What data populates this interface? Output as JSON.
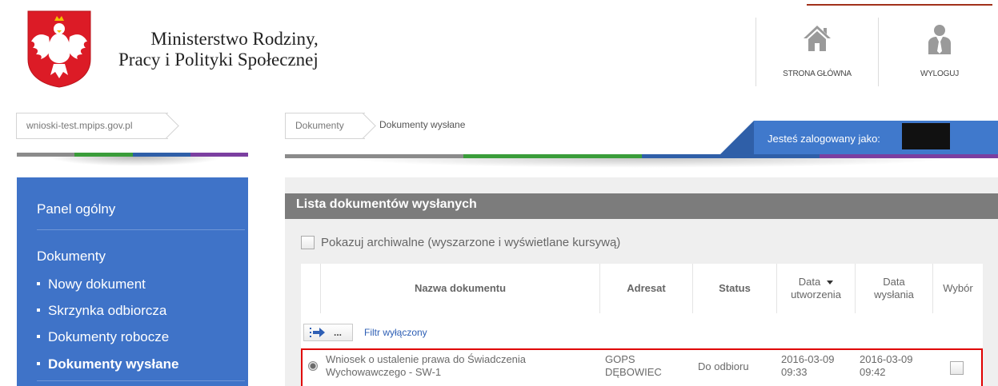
{
  "header": {
    "ministry_line1": "Ministerstwo Rodziny,",
    "ministry_line2": "Pracy i Polityki Społecznej",
    "home_label": "STRONA GŁÓWNA",
    "logout_label": "WYLOGUJ",
    "accent_color": "#a1311a"
  },
  "domain_crumb": "wnioski-test.mpips.gov.pl",
  "breadcrumb": {
    "level1": "Dokumenty",
    "level2": "Dokumenty wysłane"
  },
  "logged_in": {
    "text": "Jesteś zalogowany jako:"
  },
  "stripe_colors": [
    "#8b8b8b",
    "#3a9d3a",
    "#2f5fa8",
    "#7b3fa0"
  ],
  "sidebar": {
    "panel": "Panel ogólny",
    "section": "Dokumenty",
    "items": [
      {
        "label": "Nowy dokument"
      },
      {
        "label": "Skrzynka odbiorcza"
      },
      {
        "label": "Dokumenty robocze"
      },
      {
        "label": "Dokumenty wysłane"
      }
    ],
    "bg_color": "#3f73c8"
  },
  "list": {
    "title": "Lista dokumentów wysłanych",
    "archive_label": "Pokazuj archiwalne (wyszarzone i wyświetlane kursywą)",
    "columns": {
      "name": "Nazwa dokumentu",
      "addressee": "Adresat",
      "status": "Status",
      "created_1": "Data",
      "created_2": "utworzenia",
      "sent_1": "Data",
      "sent_2": "wysłania",
      "select": "Wybór"
    },
    "filter_button": "...",
    "filter_status": "Filtr wyłączony",
    "rows": [
      {
        "name_1": "Wniosek o ustalenie prawa do Świadczenia",
        "name_2": "Wychowawczego - SW-1",
        "addressee_1": "GOPS",
        "addressee_2": "DĘBOWIEC",
        "status": "Do odbioru",
        "created_date": "2016-03-09",
        "created_time": "09:33",
        "sent_date": "2016-03-09",
        "sent_time": "09:42"
      }
    ]
  }
}
